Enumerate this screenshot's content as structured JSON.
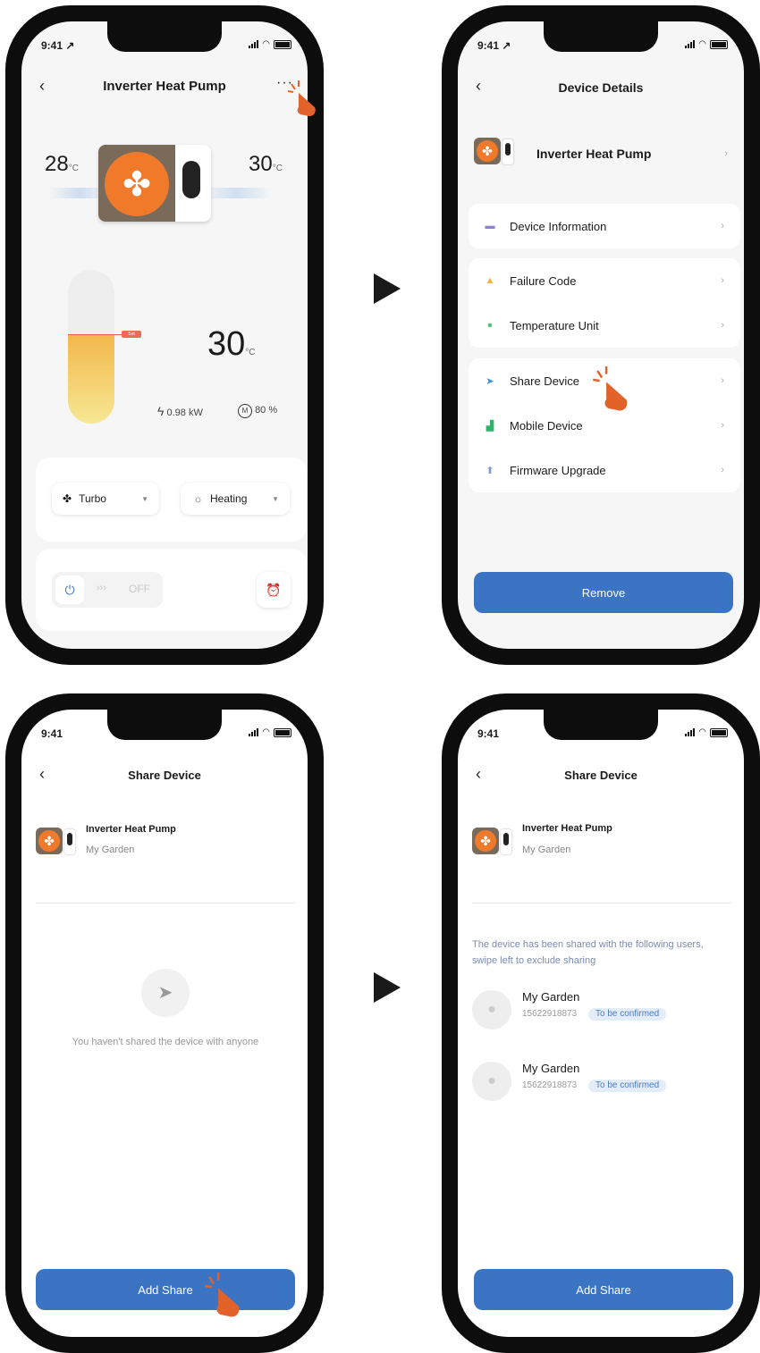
{
  "status": {
    "time_with_loc": "9:41 ↗",
    "time": "9:41"
  },
  "screen1": {
    "title": "Inverter Heat Pump",
    "temp_left": "28",
    "temp_right": "30",
    "unit": "°C",
    "water_temp": "30",
    "set_label": "Set",
    "power": "0.98 kW",
    "mode_pct": "80 %",
    "fan_mode": "Turbo",
    "run_mode": "Heating",
    "switch_state": "OFF"
  },
  "screen2": {
    "title": "Device Details",
    "device_name": "Inverter Heat Pump",
    "items": [
      {
        "label": "Device Information",
        "icon": "device-info-icon",
        "color": "#8c7fd1"
      },
      {
        "label": "Failure Code",
        "icon": "warning-icon",
        "color": "#f2b233"
      },
      {
        "label": "Temperature Unit",
        "icon": "temperature-icon",
        "color": "#58c17a"
      },
      {
        "label": "Share Device",
        "icon": "share-send-icon",
        "color": "#3a8fdc"
      },
      {
        "label": "Mobile Device",
        "icon": "mobile-device-icon",
        "color": "#2fb26a"
      },
      {
        "label": "Firmware Upgrade",
        "icon": "firmware-upgrade-icon",
        "color": "#7b9ed1"
      }
    ],
    "remove_label": "Remove"
  },
  "screen3": {
    "title": "Share Device",
    "device_name": "Inverter Heat Pump",
    "location": "My Garden",
    "empty_text": "You haven't shared the device with anyone",
    "add_label": "Add Share"
  },
  "screen4": {
    "title": "Share Device",
    "device_name": "Inverter Heat Pump",
    "location": "My Garden",
    "info_text": "The device has been shared with the following users, swipe left to exclude sharing",
    "users": [
      {
        "name": "My Garden",
        "phone": "15622918873",
        "status": "To be confirmed"
      },
      {
        "name": "My Garden",
        "phone": "15622918873",
        "status": "To be confirmed"
      }
    ],
    "add_label": "Add Share"
  },
  "colors": {
    "accent": "#3b74c2",
    "orange": "#f07a2a",
    "hand": "#e2622a"
  }
}
